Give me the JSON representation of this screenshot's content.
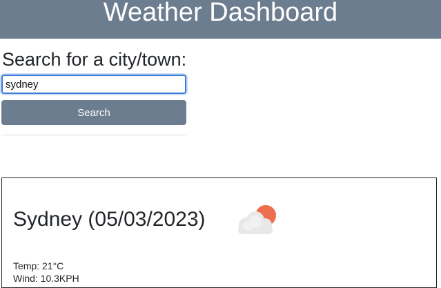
{
  "header": {
    "title": "Weather Dashboard",
    "background_color": "#6d7d90"
  },
  "search": {
    "label": "Search for a city/town:",
    "input_value": "sydney",
    "button_label": "Search"
  },
  "current": {
    "city_title": "Sydney (05/03/2023)",
    "icon": "partly-cloudy-icon",
    "temp": "Temp: 21°C",
    "wind": "Wind: 10.3KPH"
  }
}
